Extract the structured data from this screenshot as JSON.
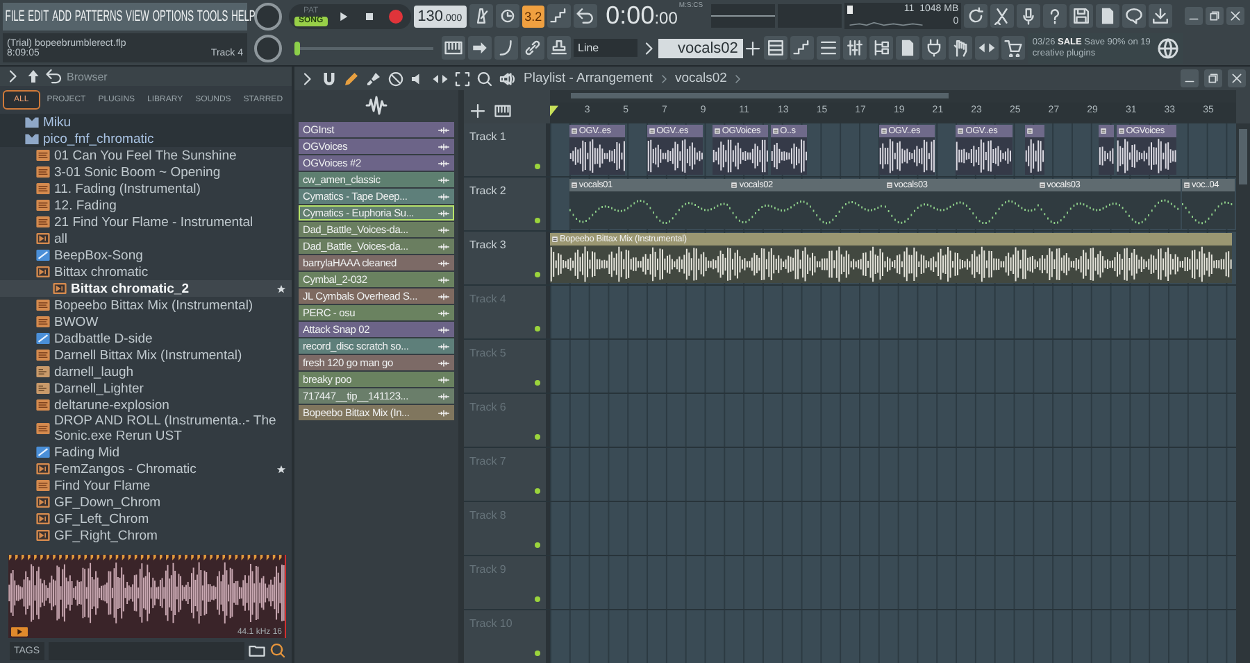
{
  "menu": [
    "FILE",
    "EDIT",
    "ADD",
    "PATTERNS",
    "VIEW",
    "OPTIONS",
    "TOOLS",
    "HELP"
  ],
  "project": {
    "title": "(Trial) bopeebrumblerect.flp",
    "time": "8:09:05",
    "track": "Track 4"
  },
  "transport": {
    "modes": [
      {
        "label": "PAT",
        "selected": false
      },
      {
        "label": "SONG",
        "selected": true
      }
    ],
    "tempo": "130",
    "tempo_fraction": ".000"
  },
  "countdown_toggle": {
    "label": "3.2",
    "on": true
  },
  "time_display": {
    "value": "0:00",
    "fraction": ":00",
    "unit": "M:S:CS"
  },
  "song_position": {
    "level": 0
  },
  "performance": {
    "cpu": "11",
    "memory": "1048 MB",
    "polyphony": "0"
  },
  "snap": {
    "value": "Line"
  },
  "pattern_selector": {
    "value": "vocals02"
  },
  "news": {
    "text": "03/26 **SALE** Save 90% on 19 creative plugins"
  },
  "browser": {
    "title": "Browser",
    "tabs": [
      {
        "label": "ALL",
        "selected": true
      },
      {
        "label": "PROJECT",
        "selected": false
      },
      {
        "label": "PLUGINS",
        "selected": false
      },
      {
        "label": "LIBRARY",
        "selected": false
      },
      {
        "label": "SOUNDS",
        "selected": false
      },
      {
        "label": "STARRED",
        "selected": false
      }
    ],
    "tree": [
      {
        "name": "Miku",
        "kind": "folder",
        "selected": false,
        "starred": false
      },
      {
        "name": "pico_fnf_chromatic",
        "kind": "folder",
        "selected": false,
        "starred": false,
        "children": [
          {
            "name": "01 Can You Feel The Sunshine",
            "kind": "audio",
            "selected": false,
            "starred": false
          },
          {
            "name": "3-01 Sonic Boom ~ Opening",
            "kind": "audio",
            "selected": false,
            "starred": false
          },
          {
            "name": "11. Fading (Instrumental)",
            "kind": "audio",
            "selected": false,
            "starred": false
          },
          {
            "name": "12. Fading",
            "kind": "audio",
            "selected": false,
            "starred": false
          },
          {
            "name": "21 Find Your Flame - Instrumental",
            "kind": "audio",
            "selected": false,
            "starred": false
          },
          {
            "name": "all",
            "kind": "pattern",
            "selected": false,
            "starred": false
          },
          {
            "name": "BeepBox-Song",
            "kind": "automation",
            "selected": false,
            "starred": false
          },
          {
            "name": "Bittax chromatic",
            "kind": "pattern",
            "selected": false,
            "starred": false,
            "children": [
              {
                "name": "Bittax chromatic_2",
                "kind": "pattern",
                "selected": true,
                "starred": true
              }
            ]
          },
          {
            "name": "Bopeebo Bittax Mix (Instrumental)",
            "kind": "audio",
            "selected": false,
            "starred": false
          },
          {
            "name": "BWOW",
            "kind": "audio",
            "selected": false,
            "starred": false
          },
          {
            "name": "Dadbattle D-side",
            "kind": "automation",
            "selected": false,
            "starred": false
          },
          {
            "name": "Darnell Bittax Mix (Instrumental)",
            "kind": "audio",
            "selected": false,
            "starred": false
          },
          {
            "name": "darnell_laugh",
            "kind": "ogg",
            "selected": false,
            "starred": false
          },
          {
            "name": "Darnell_Lighter",
            "kind": "ogg",
            "selected": false,
            "starred": false
          },
          {
            "name": "deltarune-explosion",
            "kind": "audio",
            "selected": false,
            "starred": false
          },
          {
            "name": "DROP AND ROLL (Instrumenta..- The Sonic.exe Rerun UST",
            "kind": "audio",
            "selected": false,
            "starred": false
          },
          {
            "name": "Fading Mid",
            "kind": "automation",
            "selected": false,
            "starred": false
          },
          {
            "name": "FemZangos - Chromatic",
            "kind": "pattern",
            "selected": false,
            "starred": true
          },
          {
            "name": "Find Your Flame",
            "kind": "audio",
            "selected": false,
            "starred": false
          },
          {
            "name": "GF_Down_Chrom",
            "kind": "pattern",
            "selected": false,
            "starred": false
          },
          {
            "name": "GF_Left_Chrom",
            "kind": "pattern",
            "selected": false,
            "starred": false
          },
          {
            "name": "GF_Right_Chrom",
            "kind": "pattern",
            "selected": false,
            "starred": false
          }
        ]
      }
    ],
    "preview": {
      "format": "44.1 kHz 16"
    },
    "tags_label": "TAGS"
  },
  "playlist": {
    "title": "Playlist - Arrangement",
    "pattern": "vocals02",
    "ruler": [
      "3",
      "5",
      "7",
      "9",
      "11",
      "13",
      "15",
      "17",
      "19",
      "21",
      "23",
      "25",
      "27",
      "29",
      "31",
      "33",
      "35"
    ],
    "channels": [
      {
        "name": "OGInst",
        "color": "#6c6488",
        "selected": false
      },
      {
        "name": "OGVoices",
        "color": "#6c6488",
        "selected": false
      },
      {
        "name": "OGVoices #2",
        "color": "#6c6488",
        "selected": false
      },
      {
        "name": "cw_amen_classic",
        "color": "#5e7f70",
        "selected": false
      },
      {
        "name": "Cymatics - Tape Deep...",
        "color": "#5e7f7a",
        "selected": false
      },
      {
        "name": "Cymatics - Euphoria Su...",
        "color": "#627f6e",
        "selected": true
      },
      {
        "name": "Dad_Battle_Voices-da...",
        "color": "#6a7e60",
        "selected": false
      },
      {
        "name": "Dad_Battle_Voices-da...",
        "color": "#6a7e60",
        "selected": false
      },
      {
        "name": "barrylaHAAA cleaned",
        "color": "#7c6a66",
        "selected": false
      },
      {
        "name": "Cymbal_2-032",
        "color": "#6a8260",
        "selected": false
      },
      {
        "name": "JL Cymbals Overhead S...",
        "color": "#7e6a60",
        "selected": false
      },
      {
        "name": "PERC - osu",
        "color": "#6a8260",
        "selected": false
      },
      {
        "name": "Attack Snap 02",
        "color": "#6c6488",
        "selected": false
      },
      {
        "name": "record_disc scratch so...",
        "color": "#5e7f7a",
        "selected": false
      },
      {
        "name": "fresh 120 go man go",
        "color": "#7c6a66",
        "selected": false
      },
      {
        "name": "breaky poo",
        "color": "#6a8260",
        "selected": false
      },
      {
        "name": "717447__tip__141123...",
        "color": "#6a7e6a",
        "selected": false
      },
      {
        "name": "Bopeebo Bittax Mix (In...",
        "color": "#80765e",
        "selected": false
      }
    ],
    "tracks": [
      {
        "name": "Track 1",
        "clips": [
          {
            "label": "OGV..es",
            "kind": "audio",
            "color": "#6f6a8a"
          },
          {
            "label": "OGV..es",
            "kind": "audio",
            "color": "#6f6a8a"
          },
          {
            "label": "OGVoices",
            "kind": "audio",
            "color": "#6f6a8a"
          },
          {
            "label": "O..s",
            "kind": "audio",
            "color": "#6f6a8a"
          },
          {
            "label": "OGV..es",
            "kind": "audio",
            "color": "#6f6a8a"
          },
          {
            "label": "OGV..es",
            "kind": "audio",
            "color": "#6f6a8a"
          },
          {
            "kind": "audio",
            "color": "#6f6a8a"
          },
          {
            "kind": "audio",
            "color": "#6f6a8a"
          },
          {
            "label": "OGVoices",
            "kind": "audio",
            "color": "#6f6a8a"
          }
        ]
      },
      {
        "name": "Track 2",
        "clips": [
          {
            "label": "vocals01",
            "kind": "pattern",
            "color": "#5f6b70"
          },
          {
            "label": "vocals02",
            "kind": "pattern",
            "color": "#5f6b70"
          },
          {
            "label": "vocals03",
            "kind": "pattern",
            "color": "#5f6b70"
          },
          {
            "label": "vocals03",
            "kind": "pattern",
            "color": "#5f6b70"
          },
          {
            "label": "voc..04",
            "kind": "pattern",
            "color": "#5f6b70"
          }
        ]
      },
      {
        "name": "Track 3",
        "clips": [
          {
            "label": "Bopeebo Bittax Mix (Instrumental)",
            "kind": "audio",
            "color": "#9b9772"
          }
        ]
      },
      {
        "name": "Track 4"
      },
      {
        "name": "Track 5"
      },
      {
        "name": "Track 6"
      },
      {
        "name": "Track 7"
      },
      {
        "name": "Track 8"
      },
      {
        "name": "Track 9"
      },
      {
        "name": "Track 10"
      }
    ]
  }
}
